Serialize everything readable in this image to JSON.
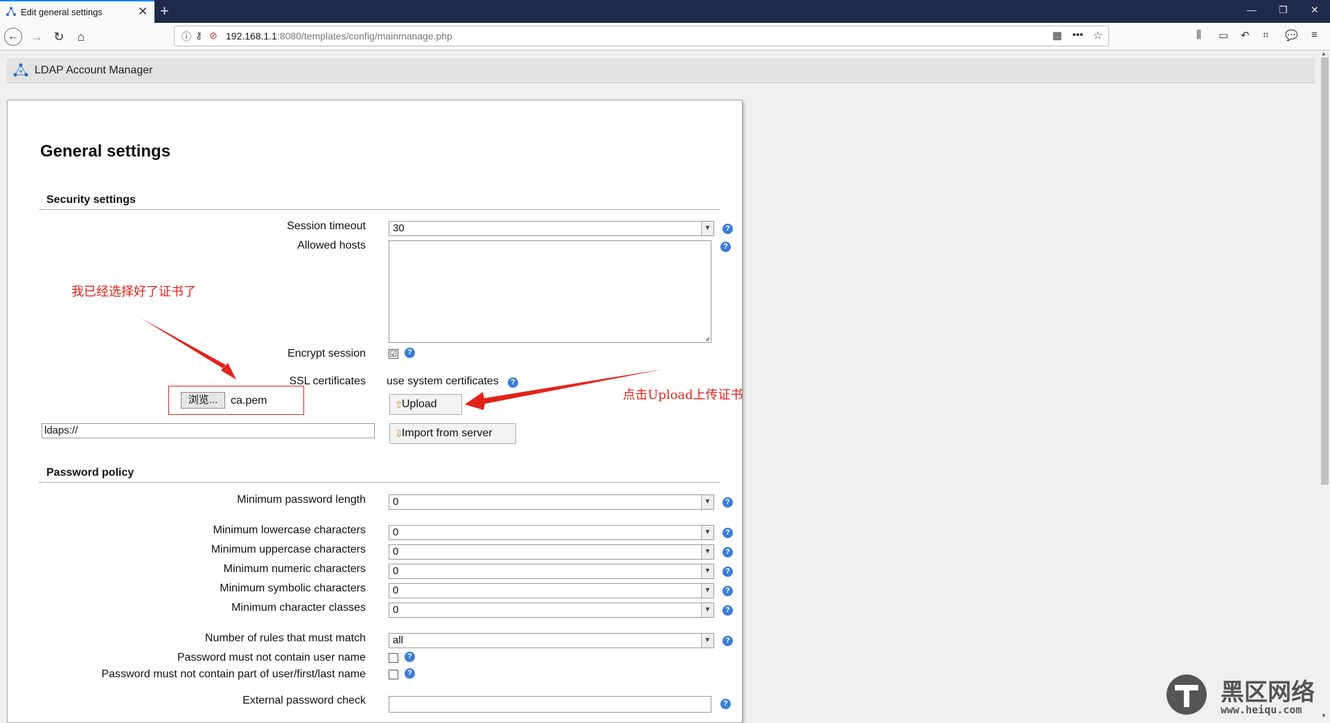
{
  "browser": {
    "tab_title": "Edit general settings",
    "tab_close": "✕",
    "new_tab": "+",
    "url_host": "192.168.1.1",
    "url_path": ":8080/templates/config/mainmanage.php",
    "window_controls": {
      "minimize": "—",
      "maximize": "❐",
      "close": "✕"
    }
  },
  "app": {
    "title": "LDAP Account Manager"
  },
  "page": {
    "title": "General settings"
  },
  "security": {
    "heading": "Security settings",
    "session_timeout": {
      "label": "Session timeout",
      "value": "30"
    },
    "allowed_hosts": {
      "label": "Allowed hosts",
      "value": ""
    },
    "encrypt_session": {
      "label": "Encrypt session",
      "checked": true,
      "mark": "☑"
    },
    "ssl": {
      "label": "SSL certificates",
      "status": "use system certificates",
      "browse_label": "浏览...",
      "file_name": "ca.pem",
      "upload_label": "Upload",
      "import_label": "Import from server",
      "server_url": "ldaps://"
    }
  },
  "password_policy": {
    "heading": "Password policy",
    "min_length": {
      "label": "Minimum password length",
      "value": "0"
    },
    "min_lowercase": {
      "label": "Minimum lowercase characters",
      "value": "0"
    },
    "min_uppercase": {
      "label": "Minimum uppercase characters",
      "value": "0"
    },
    "min_numeric": {
      "label": "Minimum numeric characters",
      "value": "0"
    },
    "min_symbolic": {
      "label": "Minimum symbolic characters",
      "value": "0"
    },
    "min_classes": {
      "label": "Minimum character classes",
      "value": "0"
    },
    "rules_match": {
      "label": "Number of rules that must match",
      "value": "all"
    },
    "no_username": {
      "label": "Password must not contain user name",
      "checked": false
    },
    "no_name_parts": {
      "label": "Password must not contain part of user/first/last name",
      "checked": false
    },
    "external_check": {
      "label": "External password check",
      "value": ""
    }
  },
  "annotations": {
    "selected_cert": "我已经选择好了证书了",
    "click_upload": "点击Upload上传证书"
  },
  "watermark": {
    "brand": "黑区网络",
    "site": "www.heiqu.com"
  },
  "colors": {
    "annotation": "#e2231a",
    "help_icon": "#3b7dd8",
    "titlebar": "#1e2a4a"
  }
}
